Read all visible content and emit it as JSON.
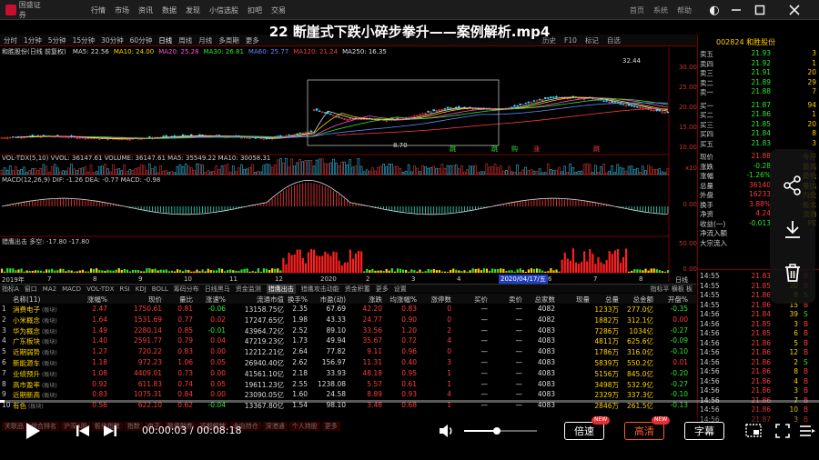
{
  "window": {
    "app_name": "国盛证券",
    "menu": [
      "行情",
      "市场",
      "资讯",
      "数据",
      "发现",
      "小信选股",
      "扣吧",
      "交易"
    ],
    "menu_right": [
      "首页",
      "系统",
      "帮助"
    ]
  },
  "video": {
    "title": "22 断崖式下跌小碎步拳升——案例解析.mp4",
    "current_time": "00:00:03",
    "duration": "00:08:18",
    "time_sep": " / ",
    "progress_fraction": 0.006,
    "volume_fraction": 0.45,
    "speed_label": "倍速",
    "quality_label": "高清",
    "subtitle_label": "字幕",
    "new_badge": "NEW"
  },
  "toolbar": {
    "items": [
      "分时",
      "1分钟",
      "5分钟",
      "15分钟",
      "30分钟",
      "60分钟",
      "日线",
      "周线",
      "月线",
      "多周期",
      "更多"
    ],
    "active_index": 6,
    "right_items": [
      "历史",
      "F10",
      "标记",
      "自选"
    ]
  },
  "chart": {
    "info": "和胜股份(日线 前复权)",
    "ma": [
      {
        "label": "MA5: 22.56",
        "color": "#dddddd"
      },
      {
        "label": "MA10: 24.00",
        "color": "#ffd400"
      },
      {
        "label": "MA20: 25.28",
        "color": "#ff4fd8"
      },
      {
        "label": "MA30: 26.81",
        "color": "#2ee62e"
      },
      {
        "label": "MA60: 25.77",
        "color": "#5a8cff"
      },
      {
        "label": "MA120: 21.24",
        "color": "#ff3b3b"
      },
      {
        "label": "MA250: 16.35",
        "color": "#dddddd"
      }
    ],
    "price_axis": [
      "30.00",
      "25.00",
      "20.00",
      "15.00",
      "10.00"
    ],
    "high_label": "32.44",
    "low_label": "8.70",
    "signals": [
      {
        "label": "跳",
        "color": "#2ee62e"
      },
      {
        "label": "跳",
        "color": "#2ee62e"
      },
      {
        "label": "购",
        "color": "#2ee62e"
      },
      {
        "label": "涨",
        "color": "#ff3b3b"
      },
      {
        "label": "跳",
        "color": "#ff3b3b"
      }
    ],
    "vol_info": "VOL-TDX(5,10)  VVOL: 36147.61   VOLUME: 36147.61   MA5: 35549.22   MA10: 30058.31",
    "vol_axis": "x10",
    "macd_info": "MACD(12,26,9)  DIF: -1.26  DEA: -0.77  MACD: -0.98",
    "macd_axis": "0.00",
    "bottom_info": "猎鹰出击  多空: -17.80   -17.80",
    "bottom_axis": "50.00",
    "date_axis": [
      "2019年",
      "7",
      "8",
      "9",
      "10",
      "11",
      "12",
      "2020",
      "2",
      "3",
      "4",
      "5",
      "6",
      "7",
      "8"
    ],
    "date_highlight": "2020/04/17/五",
    "date_right": "日线",
    "level": "0.00"
  },
  "quote": {
    "code": "002824 和胜股份",
    "sell": [
      {
        "k": "卖五",
        "v": "21.93",
        "q": "3"
      },
      {
        "k": "卖四",
        "v": "21.92",
        "q": "1"
      },
      {
        "k": "卖三",
        "v": "21.91",
        "q": "20"
      },
      {
        "k": "卖二",
        "v": "21.89",
        "q": "29"
      },
      {
        "k": "卖一",
        "v": "21.88",
        "q": "7"
      }
    ],
    "buy": [
      {
        "k": "买一",
        "v": "21.87",
        "q": "94"
      },
      {
        "k": "买二",
        "v": "21.86",
        "q": "1"
      },
      {
        "k": "买三",
        "v": "21.85",
        "q": "20"
      },
      {
        "k": "买四",
        "v": "21.84",
        "q": "8"
      },
      {
        "k": "买五",
        "v": "21.83",
        "q": "3"
      }
    ],
    "stats": [
      {
        "k": "现价",
        "v": "21.88",
        "q": "今开"
      },
      {
        "k": "涨跌",
        "v": "-0.28",
        "q": "最高"
      },
      {
        "k": "涨幅",
        "v": "-1.26%",
        "q": "最低"
      },
      {
        "k": "总量",
        "v": "36140",
        "q": "量比"
      },
      {
        "k": "外盘",
        "v": "16233",
        "q": "内盘"
      },
      {
        "k": "换手",
        "v": "3.88%",
        "q": "股本"
      },
      {
        "k": "净资",
        "v": "4.24",
        "q": "流通"
      },
      {
        "k": "收益(一)",
        "v": "-0.013",
        "q": "PE"
      }
    ],
    "flow": [
      {
        "k": "净流入额",
        "v": ""
      },
      {
        "k": "大宗流入",
        "v": ""
      }
    ]
  },
  "ticks": [
    {
      "t": "14:55",
      "p": "21.83",
      "n": "16",
      "s": "B"
    },
    {
      "t": "14:55",
      "p": "21.85",
      "n": "20",
      "s": "B"
    },
    {
      "t": "14:55",
      "p": "21.86",
      "n": "8",
      "s": "S"
    },
    {
      "t": "14:55",
      "p": "21.86",
      "n": "15",
      "s": "B"
    },
    {
      "t": "14:56",
      "p": "21.84",
      "n": "39",
      "s": "S"
    },
    {
      "t": "14:56",
      "p": "21.85",
      "n": "3",
      "s": "B"
    },
    {
      "t": "14:56",
      "p": "21.85",
      "n": "6",
      "s": "B"
    },
    {
      "t": "14:56",
      "p": "21.86",
      "n": "5",
      "s": "B"
    },
    {
      "t": "14:56",
      "p": "21.86",
      "n": "12",
      "s": "B"
    },
    {
      "t": "14:56",
      "p": "21.86",
      "n": "2",
      "s": "S"
    },
    {
      "t": "14:56",
      "p": "21.86",
      "n": "8",
      "s": "B"
    },
    {
      "t": "14:56",
      "p": "21.86",
      "n": "4",
      "s": "B"
    },
    {
      "t": "14:56",
      "p": "21.86",
      "n": "3",
      "s": "B"
    },
    {
      "t": "14:56",
      "p": "21.86",
      "n": "7",
      "s": "B"
    },
    {
      "t": "14:56",
      "p": "21.86",
      "n": "10",
      "s": "B"
    },
    {
      "t": "14:56",
      "p": "21.87",
      "n": "3",
      "s": "B"
    }
  ],
  "tabs": [
    "指标A",
    "窗口",
    "MA2",
    "MACD",
    "VOL-TDX",
    "RSI",
    "KDJ",
    "BOLL",
    "筹码分布",
    "日线黑马",
    "资金监测",
    "猎鹰出击",
    "猎鹰攻击动能",
    "资金积蓄",
    "更多",
    "设置"
  ],
  "tabs_active": 11,
  "tabs_right": [
    "指标平",
    "横板",
    "板"
  ],
  "table": {
    "headers": [
      "名称(11)",
      "涨幅%",
      "现价",
      "量比",
      "涨速%",
      "流通市值",
      "换手%",
      "市盈(动)",
      "涨跌",
      "均涨幅%",
      "涨停数",
      "买价",
      "卖价",
      "总家数",
      "现量",
      "总量",
      "总金额",
      "开盘%"
    ],
    "rows": [
      {
        "i": "1",
        "name": "消费电子",
        "tag": "(板块)",
        "c": [
          "2.47",
          "1750.61",
          "0.81",
          "-0.06",
          "13158.75亿",
          "2.35",
          "67.69",
          "42.20",
          "0.83",
          "0",
          "—",
          "—",
          "4082",
          "",
          "1233万",
          "277.0亿",
          "-0.35"
        ]
      },
      {
        "i": "2",
        "name": "小米概念",
        "tag": "(板块)",
        "c": [
          "1.64",
          "1531.69",
          "0.77",
          "0.02",
          "17247.65亿",
          "1.98",
          "43.33",
          "24.77",
          "0.90",
          "0",
          "—",
          "—",
          "4082",
          "",
          "1882万",
          "312.1亿",
          "0.00"
        ]
      },
      {
        "i": "3",
        "name": "华为概念",
        "tag": "(板块)",
        "c": [
          "1.49",
          "2280.14",
          "0.85",
          "-0.01",
          "43964.72亿",
          "2.52",
          "89.10",
          "33.56",
          "1.20",
          "2",
          "—",
          "—",
          "4083",
          "",
          "7286万",
          "1034亿",
          "-0.27"
        ]
      },
      {
        "i": "4",
        "name": "广东板块",
        "tag": "(板块)",
        "c": [
          "1.40",
          "2591.77",
          "0.79",
          "0.04",
          "47219.23亿",
          "1.73",
          "49.94",
          "35.67",
          "0.72",
          "4",
          "—",
          "—",
          "4083",
          "",
          "4811万",
          "625.6亿",
          "-0.09"
        ]
      },
      {
        "i": "5",
        "name": "近期弱势",
        "tag": "(板块)",
        "c": [
          "1.27",
          "720.22",
          "0.83",
          "0.00",
          "12212.21亿",
          "2.64",
          "77.82",
          "9.11",
          "0.96",
          "0",
          "—",
          "—",
          "4083",
          "",
          "1786万",
          "316.0亿",
          "-0.10"
        ]
      },
      {
        "i": "6",
        "name": "新能源车",
        "tag": "(板块)",
        "c": [
          "1.18",
          "972.23",
          "1.06",
          "0.05",
          "26940.40亿",
          "2.62",
          "156.97",
          "11.31",
          "0.40",
          "3",
          "—",
          "—",
          "4083",
          "",
          "5839万",
          "550.2亿",
          "0.01"
        ]
      },
      {
        "i": "7",
        "name": "业绩预升",
        "tag": "(板块)",
        "c": [
          "1.08",
          "4409.01",
          "0.73",
          "0.00",
          "41561.10亿",
          "2.18",
          "33.93",
          "48.18",
          "0.95",
          "1",
          "—",
          "—",
          "4083",
          "",
          "5156万",
          "845.0亿",
          "-0.20"
        ]
      },
      {
        "i": "8",
        "name": "高市盈率",
        "tag": "(板块)",
        "c": [
          "0.92",
          "611.83",
          "0.74",
          "0.05",
          "19611.23亿",
          "2.55",
          "1238.08",
          "5.57",
          "0.61",
          "1",
          "—",
          "—",
          "4083",
          "",
          "3498万",
          "532.9亿",
          "-0.27"
        ]
      },
      {
        "i": "9",
        "name": "近期新高",
        "tag": "(板块)",
        "c": [
          "0.83",
          "1075.31",
          "0.84",
          "0.00",
          "23090.05亿",
          "1.60",
          "24.58",
          "8.89",
          "0.93",
          "4",
          "—",
          "—",
          "4083",
          "",
          "2329万",
          "337.3亿",
          "-0.10"
        ]
      },
      {
        "i": "10",
        "name": "有色",
        "tag": "(板块)",
        "c": [
          "0.56",
          "622.10",
          "0.62",
          "-0.04",
          "13367.80亿",
          "1.54",
          "98.10",
          "3.48",
          "0.68",
          "1",
          "—",
          "—",
          "4083",
          "",
          "2846万",
          "261.5亿",
          "-0.13"
        ]
      }
    ]
  },
  "bottom_tabs": [
    "关联品",
    "综合排名",
    "沪深A股",
    "板块指数",
    "指数",
    "电子",
    "融资融券",
    "近期解禁",
    "北向持仓",
    "深港通",
    "个人持股",
    "更多"
  ]
}
